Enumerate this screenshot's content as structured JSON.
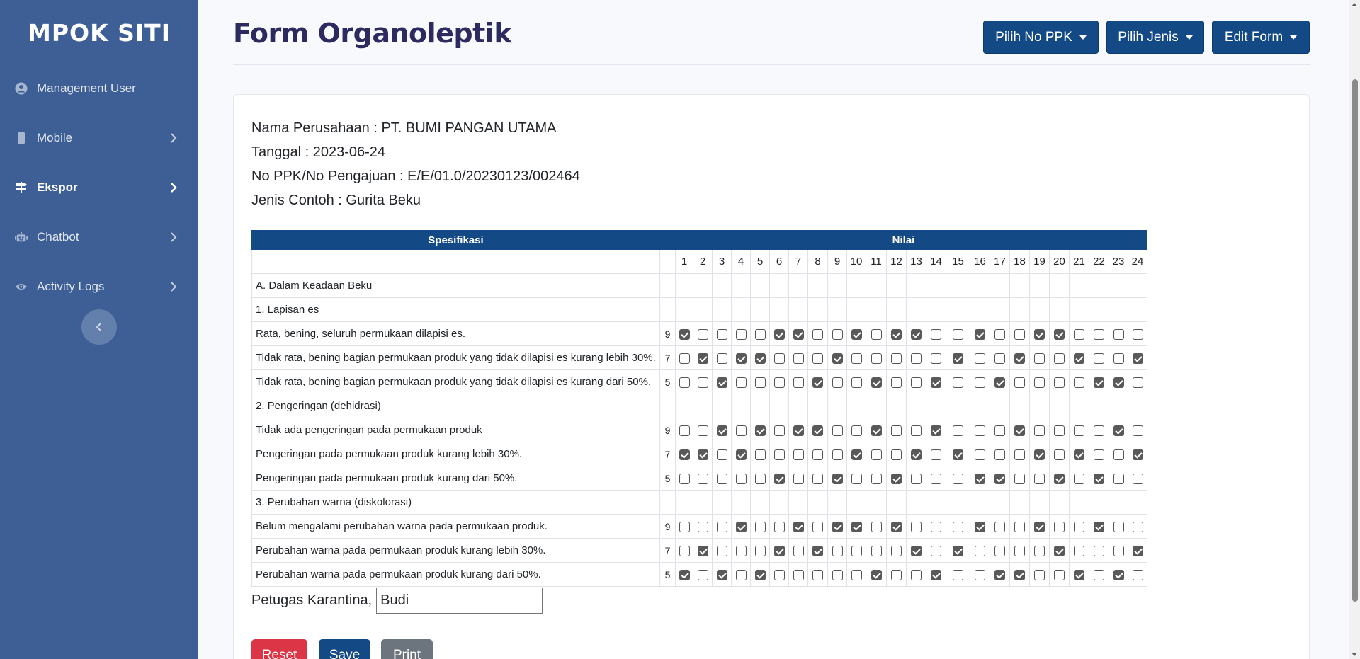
{
  "sidebar": {
    "brand": "MPOK SITI",
    "items": [
      {
        "label": "Management User",
        "icon": "user-circle-icon"
      },
      {
        "label": "Mobile",
        "icon": "mobile-icon"
      },
      {
        "label": "Ekspor",
        "icon": "signpost-icon",
        "active": true
      },
      {
        "label": "Chatbot",
        "icon": "robot-icon"
      },
      {
        "label": "Activity Logs",
        "icon": "eye-icon"
      }
    ]
  },
  "header": {
    "title": "Form Organoleptik",
    "buttons": [
      "Pilih No PPK",
      "Pilih Jenis",
      "Edit Form"
    ]
  },
  "info": {
    "perusahaan": "Nama Perusahaan : PT. BUMI PANGAN UTAMA",
    "tanggal": "Tanggal : 2023-06-24",
    "no_ppk": "No PPK/No Pengajuan : E/E/01.0/20230123/002464",
    "jenis": "Jenis Contoh : Gurita Beku"
  },
  "table": {
    "head_spec": "Spesifikasi",
    "head_nilai": "Nilai",
    "columns": [
      "1",
      "2",
      "3",
      "4",
      "5",
      "6",
      "7",
      "8",
      "9",
      "10",
      "11",
      "12",
      "13",
      "14",
      "15",
      "16",
      "17",
      "18",
      "19",
      "20",
      "21",
      "22",
      "23",
      "24"
    ],
    "rows": [
      {
        "label": "A. Dalam Keadaan Beku",
        "type": "section"
      },
      {
        "label": "1. Lapisan es",
        "type": "section"
      },
      {
        "label": "Rata, bening, seluruh permukaan dilapisi es.",
        "score": "9",
        "checks": [
          1,
          0,
          0,
          0,
          0,
          1,
          1,
          0,
          0,
          1,
          0,
          1,
          1,
          0,
          0,
          1,
          0,
          0,
          1,
          1,
          0,
          0,
          0,
          0
        ]
      },
      {
        "label": "Tidak rata, bening bagian permukaan produk yang tidak dilapisi es kurang lebih 30%.",
        "score": "7",
        "checks": [
          0,
          1,
          0,
          1,
          1,
          0,
          0,
          0,
          1,
          0,
          0,
          0,
          0,
          0,
          1,
          0,
          0,
          1,
          0,
          0,
          1,
          0,
          0,
          1
        ]
      },
      {
        "label": "Tidak rata, bening bagian permukaan produk yang tidak dilapisi es kurang dari 50%.",
        "score": "5",
        "checks": [
          0,
          0,
          1,
          0,
          0,
          0,
          0,
          1,
          0,
          0,
          1,
          0,
          0,
          1,
          0,
          0,
          1,
          0,
          0,
          0,
          0,
          1,
          1,
          0
        ]
      },
      {
        "label": "2. Pengeringan (dehidrasi)",
        "type": "section"
      },
      {
        "label": "Tidak ada pengeringan pada permukaan produk",
        "score": "9",
        "checks": [
          0,
          0,
          1,
          0,
          1,
          0,
          1,
          1,
          0,
          0,
          1,
          0,
          0,
          1,
          0,
          0,
          0,
          1,
          0,
          0,
          0,
          0,
          1,
          0
        ]
      },
      {
        "label": "Pengeringan pada permukaan produk kurang lebih 30%.",
        "score": "7",
        "checks": [
          1,
          1,
          0,
          1,
          0,
          0,
          0,
          0,
          0,
          1,
          0,
          0,
          1,
          0,
          1,
          0,
          0,
          0,
          1,
          0,
          1,
          0,
          0,
          1
        ]
      },
      {
        "label": "Pengeringan pada permukaan produk kurang dari 50%.",
        "score": "5",
        "checks": [
          0,
          0,
          0,
          0,
          0,
          1,
          0,
          0,
          1,
          0,
          0,
          1,
          0,
          0,
          0,
          1,
          1,
          0,
          0,
          1,
          0,
          1,
          0,
          0
        ]
      },
      {
        "label": "3. Perubahan warna (diskolorasi)",
        "type": "section"
      },
      {
        "label": "Belum mengalami perubahan warna pada permukaan produk.",
        "score": "9",
        "checks": [
          0,
          0,
          0,
          1,
          0,
          0,
          1,
          0,
          1,
          1,
          0,
          1,
          0,
          0,
          0,
          1,
          0,
          0,
          1,
          0,
          0,
          1,
          0,
          0
        ]
      },
      {
        "label": "Perubahan warna pada permukaan produk kurang lebih 30%.",
        "score": "7",
        "checks": [
          0,
          1,
          0,
          0,
          0,
          1,
          0,
          1,
          0,
          0,
          0,
          0,
          1,
          0,
          1,
          0,
          0,
          0,
          0,
          1,
          0,
          0,
          0,
          1
        ]
      },
      {
        "label": "Perubahan warna pada permukaan produk kurang dari 50%.",
        "score": "5",
        "checks": [
          1,
          0,
          1,
          0,
          1,
          0,
          0,
          0,
          0,
          0,
          1,
          0,
          0,
          1,
          0,
          0,
          1,
          1,
          0,
          0,
          1,
          0,
          1,
          0
        ]
      }
    ]
  },
  "petugas": {
    "label": "Petugas Karantina,",
    "value": "Budi"
  },
  "actions": {
    "reset": "Reset",
    "save": "Save",
    "print": "Print"
  },
  "colors": {
    "sidebar": "#3d5f96",
    "primary": "#134a86",
    "danger": "#dc3545",
    "secondary": "#6c757d"
  }
}
